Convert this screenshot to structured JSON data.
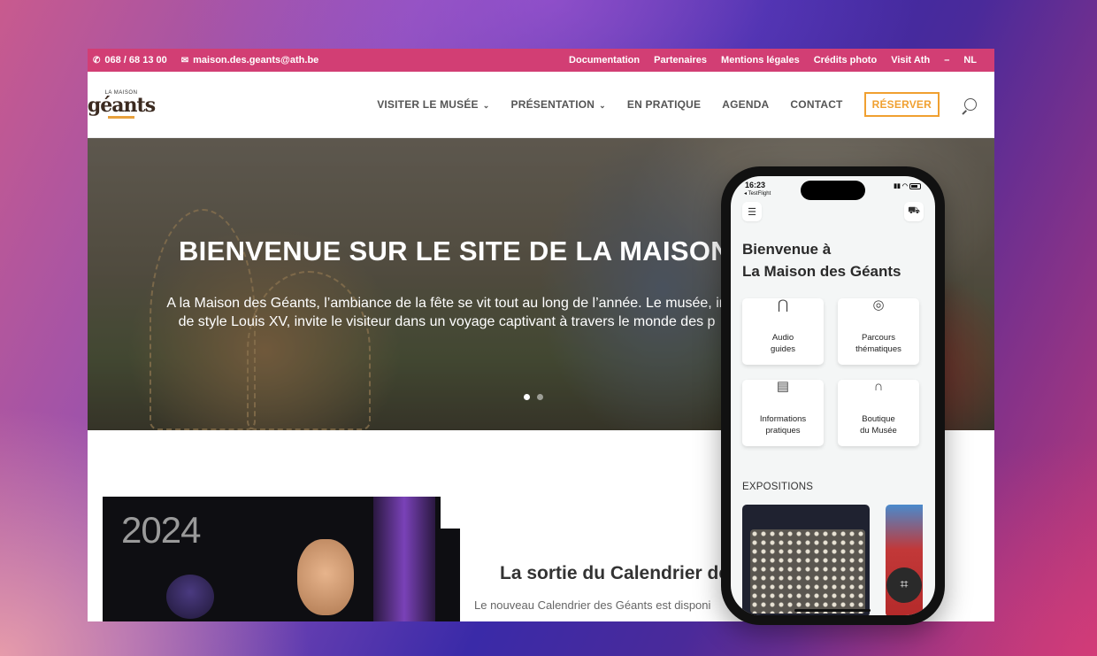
{
  "topbar": {
    "phone": "068 / 68 13 00",
    "email": "maison.des.geants@ath.be",
    "links": [
      "Documentation",
      "Partenaires",
      "Mentions légales",
      "Crédits photo",
      "Visit Ath",
      "–",
      "NL"
    ]
  },
  "logo": {
    "small": "LA MAISON",
    "big": "géants"
  },
  "nav": {
    "items": [
      "VISITER LE MUSÉE",
      "PRÉSENTATION",
      "EN PRATIQUE",
      "AGENDA",
      "CONTACT"
    ],
    "reserve": "RÉSERVER"
  },
  "hero": {
    "title": "BIENVENUE SUR LE SITE DE LA MAISON",
    "line1": "A la Maison des Géants, l’ambiance de la fête se vit tout au long de l’année. Le musée, in",
    "line2": "de style Louis XV, invite le visiteur dans un voyage captivant à travers le monde des p"
  },
  "calendar": {
    "year": "2024",
    "title": "La sortie du Calendrier de",
    "text": "Le nouveau Calendrier des Géants est disponi"
  },
  "phone": {
    "time": "16:23",
    "back": "◂ TestFlight",
    "welcome_line1": "Bienvenue à",
    "welcome_line2": "La Maison des Géants",
    "tiles": [
      {
        "line1": "Audio",
        "line2": "guides"
      },
      {
        "line1": "Parcours",
        "line2": "thématiques"
      },
      {
        "line1": "Informations",
        "line2": "pratiques"
      },
      {
        "line1": "Boutique",
        "line2": "du Musée"
      }
    ],
    "section": "EXPOSITIONS"
  },
  "colors": {
    "accent": "#d23e74",
    "reserve": "#f0a030"
  }
}
